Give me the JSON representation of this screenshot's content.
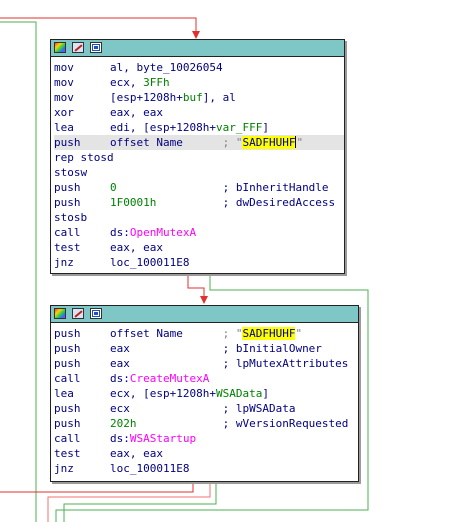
{
  "block1": {
    "lines": [
      {
        "mnem": "mov",
        "ops": [
          [
            "al, byte_10026054",
            ""
          ]
        ]
      },
      {
        "mnem": "mov",
        "ops": [
          [
            "ecx, ",
            ""
          ],
          [
            "3FFh",
            "num"
          ]
        ]
      },
      {
        "mnem": "mov",
        "ops": [
          [
            "[esp+1208h+",
            ""
          ],
          [
            "buf",
            "var"
          ],
          [
            "], al",
            ""
          ]
        ]
      },
      {
        "mnem": "xor",
        "ops": [
          [
            "eax, eax",
            ""
          ]
        ]
      },
      {
        "mnem": "lea",
        "ops": [
          [
            "edi, [esp+1208h+",
            ""
          ],
          [
            "var_FFF",
            "var"
          ],
          [
            "]",
            ""
          ]
        ]
      },
      {
        "mnem": "push",
        "ops": [
          [
            "offset Name      ",
            ""
          ],
          [
            "; \"",
            "cm"
          ],
          [
            "SADFHUHF",
            "str"
          ],
          [
            "|",
            "cursor"
          ],
          [
            "\"",
            "cm"
          ]
        ],
        "highlight": true
      },
      {
        "mnem": "rep stosd",
        "ops": []
      },
      {
        "mnem": "stosw",
        "ops": []
      },
      {
        "mnem": "push",
        "ops": [
          [
            "0",
            "num"
          ],
          [
            "                ",
            ""
          ],
          [
            "; bInheritHandle",
            "cmt"
          ]
        ]
      },
      {
        "mnem": "push",
        "ops": [
          [
            "1F0001h",
            "num"
          ],
          [
            "          ",
            ""
          ],
          [
            "; dwDesiredAccess",
            "cmt"
          ]
        ]
      },
      {
        "mnem": "stosb",
        "ops": []
      },
      {
        "mnem": "call",
        "ops": [
          [
            "ds:",
            ""
          ],
          [
            "OpenMutexA",
            "fn"
          ]
        ]
      },
      {
        "mnem": "test",
        "ops": [
          [
            "eax, eax",
            ""
          ]
        ]
      },
      {
        "mnem": "jnz",
        "ops": [
          [
            "loc_100011E8",
            ""
          ]
        ]
      }
    ]
  },
  "block2": {
    "lines": [
      {
        "mnem": "push",
        "ops": [
          [
            "offset Name      ",
            ""
          ],
          [
            "; \"",
            "cm"
          ],
          [
            "SADFHUHF",
            "str"
          ],
          [
            "\"",
            "cm"
          ]
        ]
      },
      {
        "mnem": "push",
        "ops": [
          [
            "eax",
            ""
          ],
          [
            "              ",
            ""
          ],
          [
            "; bInitialOwner",
            "cmt"
          ]
        ]
      },
      {
        "mnem": "push",
        "ops": [
          [
            "eax",
            ""
          ],
          [
            "              ",
            ""
          ],
          [
            "; lpMutexAttributes",
            "cmt"
          ]
        ]
      },
      {
        "mnem": "call",
        "ops": [
          [
            "ds:",
            ""
          ],
          [
            "CreateMutexA",
            "fn"
          ]
        ]
      },
      {
        "mnem": "lea",
        "ops": [
          [
            "ecx, [esp+1208h+",
            ""
          ],
          [
            "WSAData",
            "var"
          ],
          [
            "]",
            ""
          ]
        ]
      },
      {
        "mnem": "push",
        "ops": [
          [
            "ecx",
            ""
          ],
          [
            "              ",
            ""
          ],
          [
            "; lpWSAData",
            "cmt"
          ]
        ]
      },
      {
        "mnem": "push",
        "ops": [
          [
            "202h",
            "num"
          ],
          [
            "             ",
            ""
          ],
          [
            "; wVersionRequested",
            "cmt"
          ]
        ]
      },
      {
        "mnem": "call",
        "ops": [
          [
            "ds:",
            ""
          ],
          [
            "WSAStartup",
            "fn"
          ]
        ]
      },
      {
        "mnem": "test",
        "ops": [
          [
            "eax, eax",
            ""
          ]
        ]
      },
      {
        "mnem": "jnz",
        "ops": [
          [
            "loc_100011E8",
            ""
          ]
        ]
      }
    ]
  },
  "colors": {
    "title_bar": "#7fc7c7",
    "edge_red": "#e03030",
    "edge_green": "#4caf50",
    "edge_pink": "#f07070"
  }
}
